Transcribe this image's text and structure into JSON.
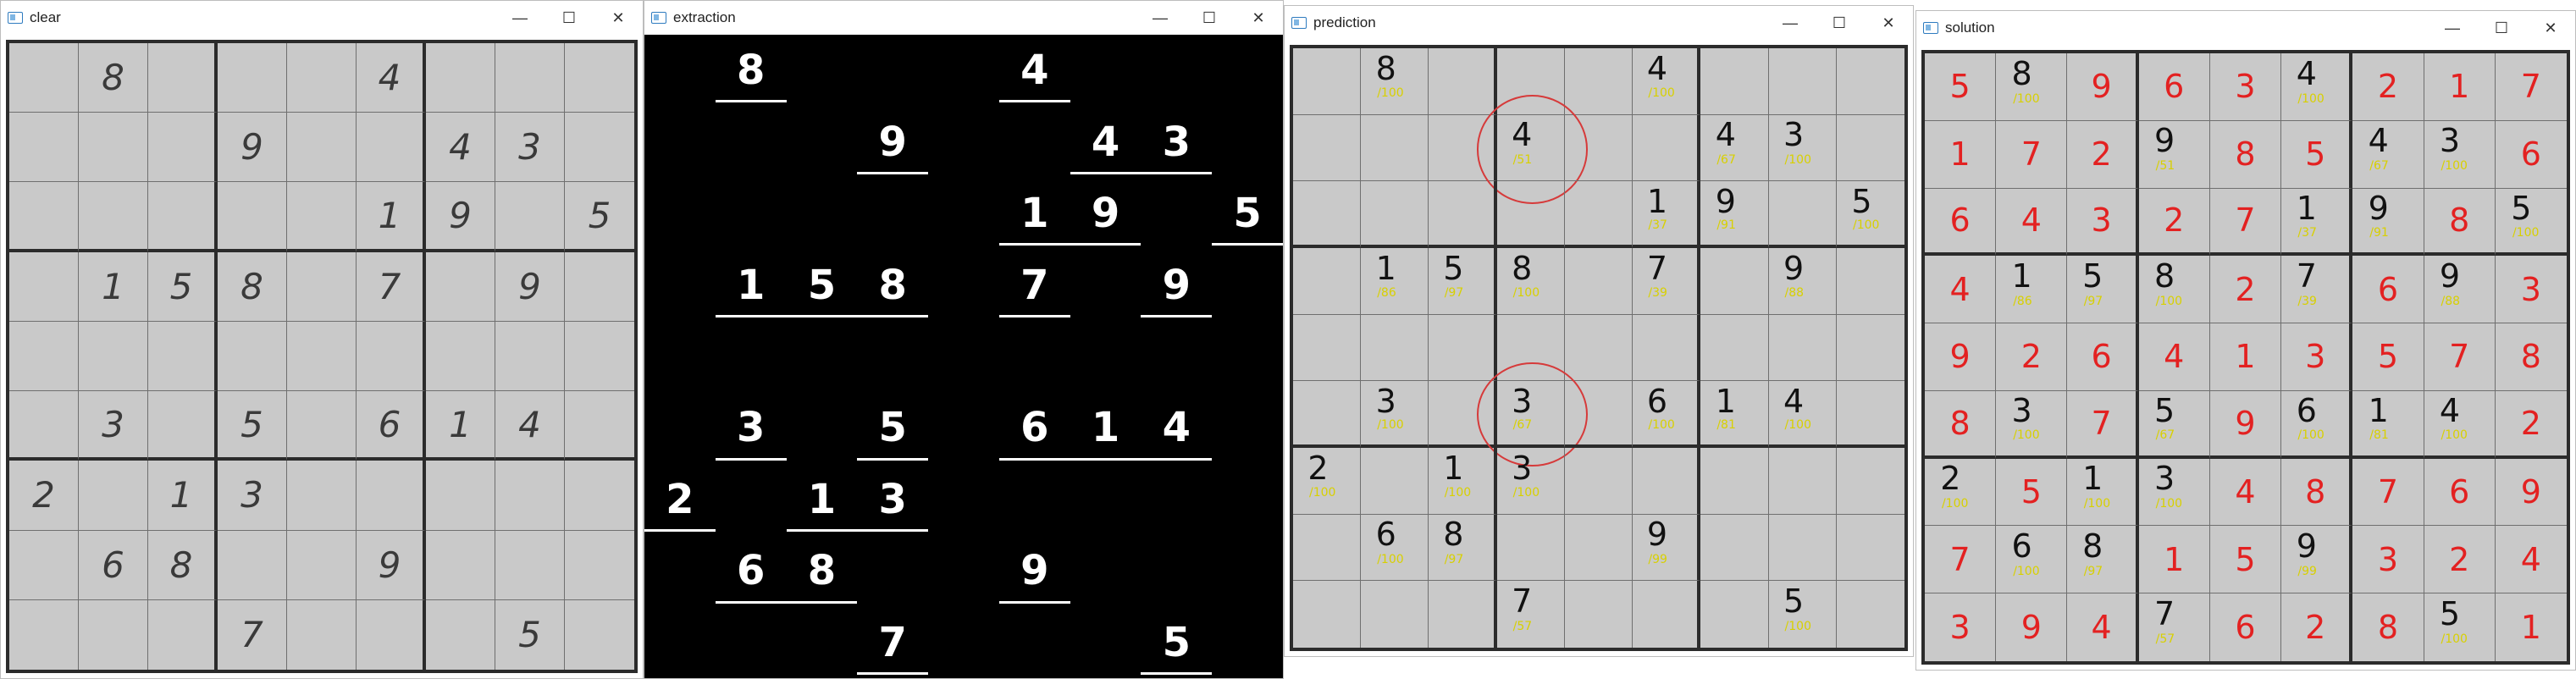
{
  "windows": [
    {
      "title": "clear"
    },
    {
      "title": "extraction"
    },
    {
      "title": "prediction"
    },
    {
      "title": "solution"
    }
  ],
  "controls": {
    "minimize": "—",
    "maximize": "☐",
    "close": "✕"
  },
  "grid": [
    [
      "",
      "8",
      "",
      "",
      "",
      "4",
      "",
      "",
      ""
    ],
    [
      "",
      "",
      "",
      "9",
      "",
      "",
      "4",
      "3",
      ""
    ],
    [
      "",
      "",
      "",
      "",
      "",
      "1",
      "9",
      "",
      "5"
    ],
    [
      "",
      "1",
      "5",
      "8",
      "",
      "7",
      "",
      "9",
      ""
    ],
    [
      "",
      "",
      "",
      "",
      "",
      "",
      "",
      "",
      ""
    ],
    [
      "",
      "3",
      "",
      "5",
      "",
      "6",
      "1",
      "4",
      ""
    ],
    [
      "2",
      "",
      "1",
      "3",
      "",
      "",
      "",
      "",
      ""
    ],
    [
      "",
      "6",
      "8",
      "",
      "",
      "9",
      "",
      "",
      ""
    ],
    [
      "",
      "",
      "",
      "7",
      "",
      "",
      "",
      "5",
      ""
    ]
  ],
  "prediction_grid": [
    [
      "",
      "8",
      "",
      "",
      "",
      "4",
      "",
      "",
      ""
    ],
    [
      "",
      "",
      "",
      "4",
      "",
      "",
      "4",
      "3",
      ""
    ],
    [
      "",
      "",
      "",
      "",
      "",
      "1",
      "9",
      "",
      "5"
    ],
    [
      "",
      "1",
      "5",
      "8",
      "",
      "7",
      "",
      "9",
      ""
    ],
    [
      "",
      "",
      "",
      "",
      "",
      "",
      "",
      "",
      ""
    ],
    [
      "",
      "3",
      "",
      "3",
      "",
      "6",
      "1",
      "4",
      ""
    ],
    [
      "2",
      "",
      "1",
      "3",
      "",
      "",
      "",
      "",
      ""
    ],
    [
      "",
      "6",
      "8",
      "",
      "",
      "9",
      "",
      "",
      ""
    ],
    [
      "",
      "",
      "",
      "7",
      "",
      "",
      "",
      "5",
      ""
    ]
  ],
  "confidence": [
    [
      "",
      "/100",
      "",
      "",
      "",
      "/100",
      "",
      "",
      ""
    ],
    [
      "",
      "",
      "",
      "/51",
      "",
      "",
      "/67",
      "/100",
      ""
    ],
    [
      "",
      "",
      "",
      "",
      "",
      "/37",
      "/91",
      "",
      "/100"
    ],
    [
      "",
      "/86",
      "/97",
      "/100",
      "",
      "/39",
      "",
      "/88",
      ""
    ],
    [
      "",
      "",
      "",
      "",
      "",
      "",
      "",
      "",
      ""
    ],
    [
      "",
      "/100",
      "",
      "/67",
      "",
      "/100",
      "/81",
      "/100",
      ""
    ],
    [
      "/100",
      "",
      "/100",
      "/100",
      "",
      "",
      "",
      "",
      ""
    ],
    [
      "",
      "/100",
      "/97",
      "",
      "",
      "/99",
      "",
      "",
      ""
    ],
    [
      "",
      "",
      "",
      "/57",
      "",
      "",
      "",
      "/100",
      ""
    ]
  ],
  "solution": [
    [
      "5",
      "8",
      "9",
      "6",
      "3",
      "4",
      "2",
      "1",
      "7"
    ],
    [
      "1",
      "7",
      "2",
      "9",
      "8",
      "5",
      "4",
      "3",
      "6"
    ],
    [
      "6",
      "4",
      "3",
      "2",
      "7",
      "1",
      "9",
      "8",
      "5"
    ],
    [
      "4",
      "1",
      "5",
      "8",
      "2",
      "7",
      "6",
      "9",
      "3"
    ],
    [
      "9",
      "2",
      "6",
      "4",
      "1",
      "3",
      "5",
      "7",
      "8"
    ],
    [
      "8",
      "3",
      "7",
      "5",
      "9",
      "6",
      "1",
      "4",
      "2"
    ],
    [
      "2",
      "5",
      "1",
      "3",
      "4",
      "8",
      "7",
      "6",
      "9"
    ],
    [
      "7",
      "6",
      "8",
      "1",
      "5",
      "9",
      "3",
      "2",
      "4"
    ],
    [
      "3",
      "9",
      "4",
      "7",
      "6",
      "2",
      "8",
      "5",
      "1"
    ]
  ],
  "flagged_cells": [
    [
      1,
      3
    ],
    [
      5,
      3
    ]
  ],
  "colors": {
    "solved_digit": "#e32121",
    "confidence": "#d8d000",
    "flag_circle": "#d63a3a"
  }
}
